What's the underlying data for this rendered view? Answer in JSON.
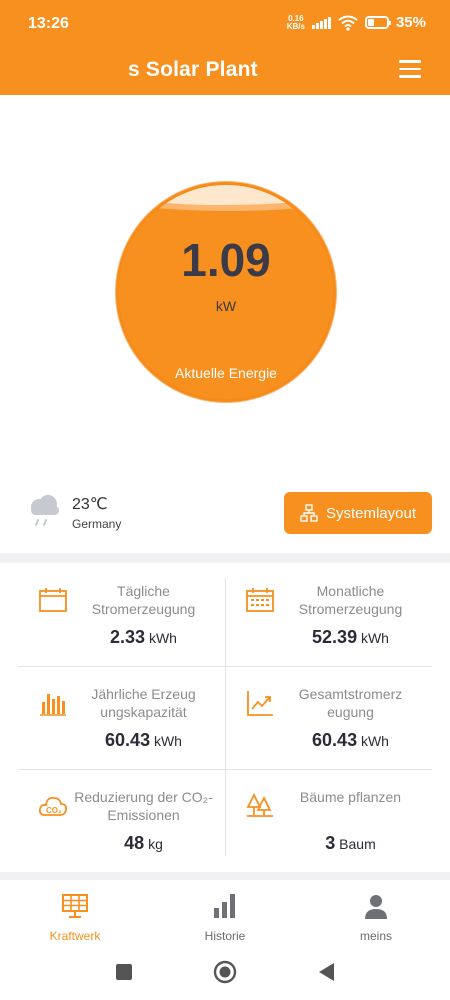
{
  "status_bar": {
    "time": "13:26",
    "net_speed_value": "0.16",
    "net_speed_unit": "KB/s",
    "battery": "35%",
    "battery_level": 0.35
  },
  "header": {
    "title": "s Solar Plant"
  },
  "energy": {
    "value": "1.09",
    "unit": "kW",
    "label": "Aktuelle Energie"
  },
  "weather": {
    "temperature": "23℃",
    "location": "Germany"
  },
  "system_layout_button": "Systemlayout",
  "stats": [
    {
      "label": "Tägliche Stromerzeugung",
      "value": "2.33",
      "unit": "kWh",
      "icon": "calendar-day-icon"
    },
    {
      "label": "Monatliche Stromerzeugung",
      "value": "52.39",
      "unit": "kWh",
      "icon": "calendar-month-icon"
    },
    {
      "label": "Jährliche Erzeug ungskapazität",
      "value": "60.43",
      "unit": "kWh",
      "icon": "bar-chart-icon"
    },
    {
      "label": "Gesamtstromerz eugung",
      "value": "60.43",
      "unit": "kWh",
      "icon": "trend-up-icon"
    },
    {
      "label": "Reduzierung der CO₂-Emissionen",
      "value": "48",
      "unit": "kg",
      "icon": "co2-cloud-icon"
    },
    {
      "label": "Bäume pflanzen",
      "value": "3",
      "unit": "Baum",
      "icon": "trees-icon"
    }
  ],
  "bottom_nav": [
    {
      "label": "Kraftwerk",
      "icon": "solar-panel-icon",
      "active": true
    },
    {
      "label": "Historie",
      "icon": "bar-chart-icon",
      "active": false
    },
    {
      "label": "meins",
      "icon": "person-icon",
      "active": false
    }
  ],
  "colors": {
    "accent": "#f7901e",
    "text_dark": "#2c2c38",
    "text_muted": "#8c8c8c"
  }
}
